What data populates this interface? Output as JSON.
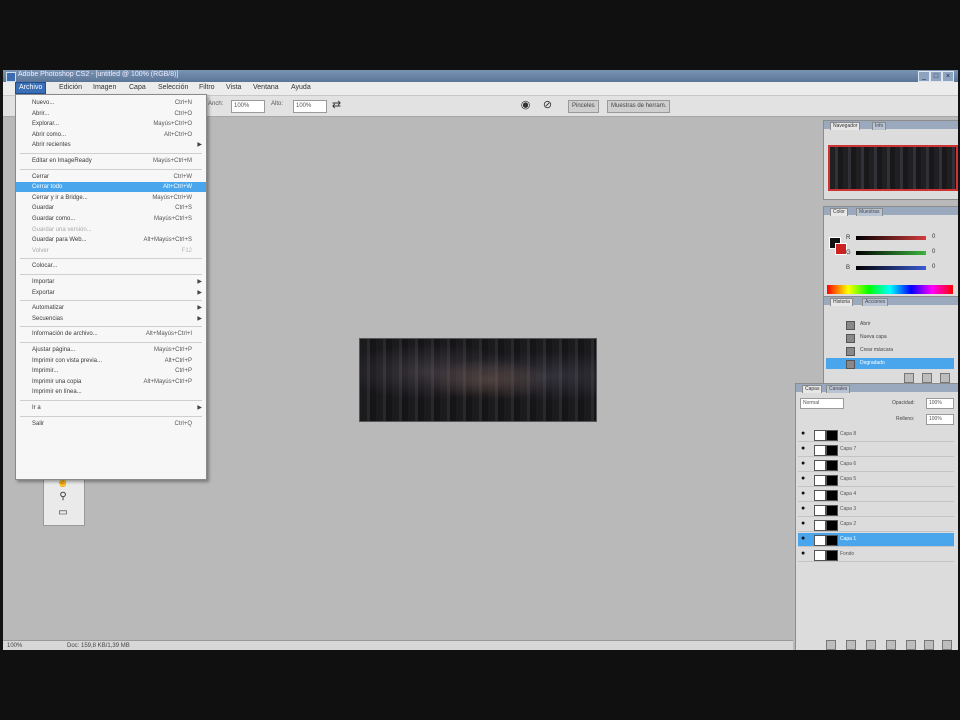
{
  "window": {
    "title": "Adobe Photoshop CS2 - [untitled @ 100% (RGB/8)]"
  },
  "menubar": {
    "items": [
      {
        "id": "archivo",
        "label": "Archivo"
      },
      {
        "id": "edicion",
        "label": "Edición"
      },
      {
        "id": "imagen",
        "label": "Imagen"
      },
      {
        "id": "capa",
        "label": "Capa"
      },
      {
        "id": "seleccion",
        "label": "Selección"
      },
      {
        "id": "filtro",
        "label": "Filtro"
      },
      {
        "id": "vista",
        "label": "Vista"
      },
      {
        "id": "ventana",
        "label": "Ventana"
      },
      {
        "id": "ayuda",
        "label": "Ayuda"
      }
    ]
  },
  "options_bar": {
    "width_label": "Anch:",
    "width_value": "100%",
    "height_label": "Alto:",
    "height_value": "100%",
    "tab1": "Pinceles",
    "tab2": "Muestras de herram."
  },
  "file_menu": {
    "items": [
      {
        "label": "Nuevo...",
        "shortcut": "Ctrl+N"
      },
      {
        "label": "Abrir...",
        "shortcut": "Ctrl+O"
      },
      {
        "label": "Explorar...",
        "shortcut": "Mayús+Ctrl+O"
      },
      {
        "label": "Abrir como...",
        "shortcut": "Alt+Ctrl+O"
      },
      {
        "label": "Abrir recientes",
        "submenu": true
      },
      {
        "separator": true
      },
      {
        "label": "Editar en ImageReady",
        "shortcut": "Mayús+Ctrl+M"
      },
      {
        "separator": true
      },
      {
        "label": "Cerrar",
        "shortcut": "Ctrl+W"
      },
      {
        "label": "Cerrar todo",
        "shortcut": "Alt+Ctrl+W",
        "highlighted": true
      },
      {
        "label": "Cerrar y ir a Bridge...",
        "shortcut": "Mayús+Ctrl+W"
      },
      {
        "label": "Guardar",
        "shortcut": "Ctrl+S"
      },
      {
        "label": "Guardar como...",
        "shortcut": "Mayús+Ctrl+S"
      },
      {
        "label": "Guardar una versión...",
        "disabled": true
      },
      {
        "label": "Guardar para Web...",
        "shortcut": "Alt+Mayús+Ctrl+S"
      },
      {
        "label": "Volver",
        "shortcut": "F12",
        "disabled": true
      },
      {
        "separator": true
      },
      {
        "label": "Colocar..."
      },
      {
        "separator": true
      },
      {
        "label": "Importar",
        "submenu": true
      },
      {
        "label": "Exportar",
        "submenu": true
      },
      {
        "separator": true
      },
      {
        "label": "Automatizar",
        "submenu": true
      },
      {
        "label": "Secuencias",
        "submenu": true
      },
      {
        "separator": true
      },
      {
        "label": "Información de archivo...",
        "shortcut": "Alt+Mayús+Ctrl+I"
      },
      {
        "separator": true
      },
      {
        "label": "Ajustar página...",
        "shortcut": "Mayús+Ctrl+P"
      },
      {
        "label": "Imprimir con vista previa...",
        "shortcut": "Alt+Ctrl+P"
      },
      {
        "label": "Imprimir...",
        "shortcut": "Ctrl+P"
      },
      {
        "label": "Imprimir una copia",
        "shortcut": "Alt+Mayús+Ctrl+P"
      },
      {
        "label": "Imprimir en línea..."
      },
      {
        "separator": true
      },
      {
        "label": "Ir a",
        "submenu": true
      },
      {
        "separator": true
      },
      {
        "label": "Salir",
        "shortcut": "Ctrl+Q"
      }
    ]
  },
  "navigator": {
    "tab_active": "Navegador",
    "tab_inactive": "Info"
  },
  "color_panel": {
    "tab_active": "Color",
    "tab_inactive": "Muestras",
    "sliders": [
      {
        "label": "R",
        "value": "0",
        "color": "#d23c3c"
      },
      {
        "label": "G",
        "value": "0",
        "color": "#3cb43c"
      },
      {
        "label": "B",
        "value": "0",
        "color": "#3c5ad2"
      }
    ]
  },
  "history_panel": {
    "tab_active": "Historia",
    "tab_inactive": "Acciones",
    "items": [
      {
        "label": "Abrir"
      },
      {
        "label": "Nueva capa"
      },
      {
        "label": "Crear máscara"
      },
      {
        "label": "Degradado",
        "selected": true
      }
    ]
  },
  "layers_panel": {
    "tab_active": "Capas",
    "tab_inactive": "Canales",
    "mode": "Normal",
    "opacity_label": "Opacidad:",
    "opacity_value": "100%",
    "fill_label": "Relleno:",
    "fill_value": "100%",
    "layers": [
      {
        "name": "Capa 8"
      },
      {
        "name": "Capa 7"
      },
      {
        "name": "Capa 6"
      },
      {
        "name": "Capa 5"
      },
      {
        "name": "Capa 4"
      },
      {
        "name": "Capa 3"
      },
      {
        "name": "Capa 2"
      },
      {
        "name": "Capa 1",
        "selected": true
      },
      {
        "name": "Fondo"
      }
    ]
  },
  "statusbar": {
    "zoom": "100%",
    "doc_info": "Doc: 159,8 KB/1,39 MB"
  }
}
